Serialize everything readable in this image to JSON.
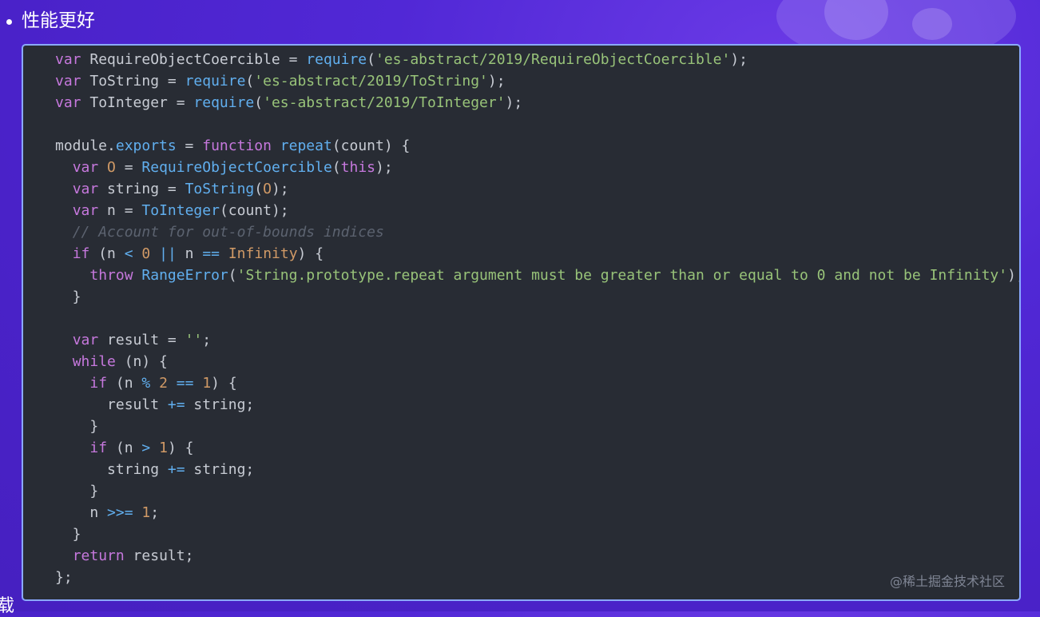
{
  "heading": "性能更好",
  "watermark": "@稀土掘金技术社区",
  "cut_char": "载",
  "code": {
    "language": "javascript",
    "lines": [
      [
        [
          "kw",
          "var"
        ],
        [
          "t",
          " RequireObjectCoercible = "
        ],
        [
          "fn",
          "require"
        ],
        [
          "t",
          "("
        ],
        [
          "str",
          "'es-abstract/2019/RequireObjectCoercible'"
        ],
        [
          "t",
          ");"
        ]
      ],
      [
        [
          "kw",
          "var"
        ],
        [
          "t",
          " ToString = "
        ],
        [
          "fn",
          "require"
        ],
        [
          "t",
          "("
        ],
        [
          "str",
          "'es-abstract/2019/ToString'"
        ],
        [
          "t",
          ");"
        ]
      ],
      [
        [
          "kw",
          "var"
        ],
        [
          "t",
          " ToInteger = "
        ],
        [
          "fn",
          "require"
        ],
        [
          "t",
          "("
        ],
        [
          "str",
          "'es-abstract/2019/ToInteger'"
        ],
        [
          "t",
          ");"
        ]
      ],
      [],
      [
        [
          "t",
          "module."
        ],
        [
          "fn",
          "exports"
        ],
        [
          "t",
          " = "
        ],
        [
          "kw",
          "function"
        ],
        [
          "t",
          " "
        ],
        [
          "fn",
          "repeat"
        ],
        [
          "t",
          "(count) {"
        ]
      ],
      [
        [
          "t",
          "  "
        ],
        [
          "kw",
          "var"
        ],
        [
          "t",
          " "
        ],
        [
          "num",
          "O"
        ],
        [
          "t",
          " = "
        ],
        [
          "fn",
          "RequireObjectCoercible"
        ],
        [
          "t",
          "("
        ],
        [
          "kw",
          "this"
        ],
        [
          "t",
          ");"
        ]
      ],
      [
        [
          "t",
          "  "
        ],
        [
          "kw",
          "var"
        ],
        [
          "t",
          " string = "
        ],
        [
          "fn",
          "ToString"
        ],
        [
          "t",
          "("
        ],
        [
          "num",
          "O"
        ],
        [
          "t",
          ");"
        ]
      ],
      [
        [
          "t",
          "  "
        ],
        [
          "kw",
          "var"
        ],
        [
          "t",
          " n = "
        ],
        [
          "fn",
          "ToInteger"
        ],
        [
          "t",
          "(count);"
        ]
      ],
      [
        [
          "t",
          "  "
        ],
        [
          "com",
          "// Account for out-of-bounds indices"
        ]
      ],
      [
        [
          "t",
          "  "
        ],
        [
          "kw",
          "if"
        ],
        [
          "t",
          " (n "
        ],
        [
          "fn",
          "<"
        ],
        [
          "t",
          " "
        ],
        [
          "num",
          "0"
        ],
        [
          "t",
          " "
        ],
        [
          "fn",
          "||"
        ],
        [
          "t",
          " n "
        ],
        [
          "fn",
          "=="
        ],
        [
          "t",
          " "
        ],
        [
          "num",
          "Infinity"
        ],
        [
          "t",
          ") {"
        ]
      ],
      [
        [
          "t",
          "    "
        ],
        [
          "kw",
          "throw"
        ],
        [
          "t",
          " "
        ],
        [
          "fn",
          "RangeError"
        ],
        [
          "t",
          "("
        ],
        [
          "str",
          "'String.prototype.repeat argument must be greater than or equal to 0 and not be Infinity'"
        ],
        [
          "t",
          ");"
        ]
      ],
      [
        [
          "t",
          "  }"
        ]
      ],
      [],
      [
        [
          "t",
          "  "
        ],
        [
          "kw",
          "var"
        ],
        [
          "t",
          " result = "
        ],
        [
          "str",
          "''"
        ],
        [
          "t",
          ";"
        ]
      ],
      [
        [
          "t",
          "  "
        ],
        [
          "kw",
          "while"
        ],
        [
          "t",
          " (n) {"
        ]
      ],
      [
        [
          "t",
          "    "
        ],
        [
          "kw",
          "if"
        ],
        [
          "t",
          " (n "
        ],
        [
          "fn",
          "%"
        ],
        [
          "t",
          " "
        ],
        [
          "num",
          "2"
        ],
        [
          "t",
          " "
        ],
        [
          "fn",
          "=="
        ],
        [
          "t",
          " "
        ],
        [
          "num",
          "1"
        ],
        [
          "t",
          ") {"
        ]
      ],
      [
        [
          "t",
          "      result "
        ],
        [
          "fn",
          "+="
        ],
        [
          "t",
          " string;"
        ]
      ],
      [
        [
          "t",
          "    }"
        ]
      ],
      [
        [
          "t",
          "    "
        ],
        [
          "kw",
          "if"
        ],
        [
          "t",
          " (n "
        ],
        [
          "fn",
          ">"
        ],
        [
          "t",
          " "
        ],
        [
          "num",
          "1"
        ],
        [
          "t",
          ") {"
        ]
      ],
      [
        [
          "t",
          "      string "
        ],
        [
          "fn",
          "+="
        ],
        [
          "t",
          " string;"
        ]
      ],
      [
        [
          "t",
          "    }"
        ]
      ],
      [
        [
          "t",
          "    n "
        ],
        [
          "fn",
          ">>="
        ],
        [
          "t",
          " "
        ],
        [
          "num",
          "1"
        ],
        [
          "t",
          ";"
        ]
      ],
      [
        [
          "t",
          "  }"
        ]
      ],
      [
        [
          "t",
          "  "
        ],
        [
          "kw",
          "return"
        ],
        [
          "t",
          " result;"
        ]
      ],
      [
        [
          "t",
          "};"
        ]
      ]
    ]
  }
}
